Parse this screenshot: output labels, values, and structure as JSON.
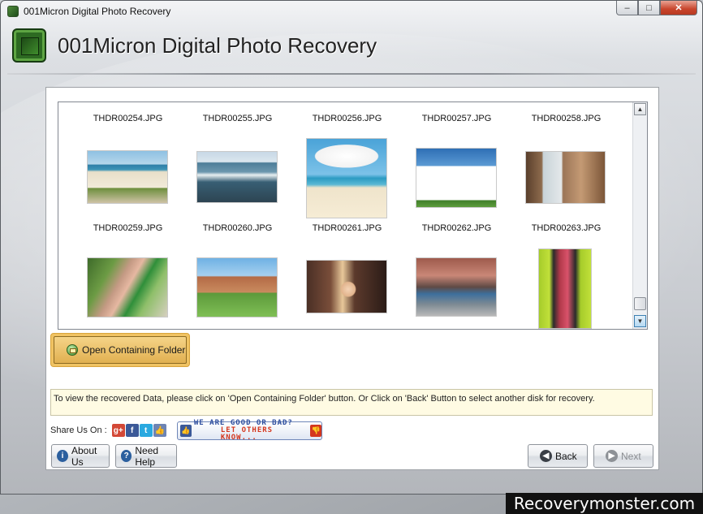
{
  "window": {
    "title": "001Micron Digital Photo Recovery",
    "controls": {
      "minimize": "–",
      "maximize": "□",
      "close": "✕"
    }
  },
  "header": {
    "title": "001Micron Digital Photo Recovery",
    "icon": "chip-icon"
  },
  "thumbnails": {
    "row1_names": [
      "THDR00254.JPG",
      "THDR00255.JPG",
      "THDR00256.JPG",
      "THDR00257.JPG",
      "THDR00258.JPG"
    ],
    "row2_names": [
      "THDR00259.JPG",
      "THDR00260.JPG",
      "THDR00261.JPG",
      "THDR00262.JPG",
      "THDR00263.JPG"
    ]
  },
  "scrollbar": {
    "up": "▲",
    "down": "▼"
  },
  "open_folder": {
    "label": "Open Containing Folder"
  },
  "info_text": "To view the recovered Data, please click on 'Open Containing Folder' button. Or Click on 'Back' Button to select another disk for recovery.",
  "share": {
    "label": "Share Us On :",
    "icons": [
      "g+",
      "f",
      "t",
      "like"
    ],
    "feedback_line1": "WE ARE GOOD OR BAD?",
    "feedback_line2": "LET OTHERS KNOW..."
  },
  "buttons": {
    "about": "About Us",
    "help": "Need Help",
    "back": "Back",
    "next": "Next",
    "about_icon": "i",
    "help_icon": "?",
    "back_icon": "◀",
    "next_icon": "▶"
  },
  "watermark": "Recoverymonster.com"
}
